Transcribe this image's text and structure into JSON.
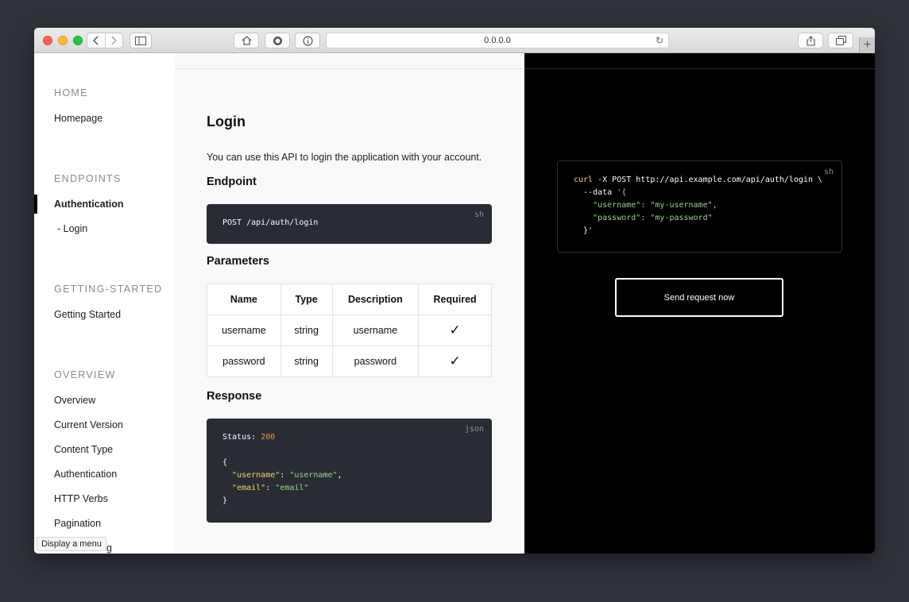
{
  "browser": {
    "url": "0.0.0.0",
    "colors": {
      "close": "#fc5f57",
      "minimize": "#fdbb2e",
      "zoom": "#28c840"
    }
  },
  "sidebar": {
    "sections": [
      {
        "title": "HOME",
        "items": [
          "Homepage"
        ]
      },
      {
        "title": "ENDPOINTS",
        "items": [
          "Authentication",
          "- Login"
        ]
      },
      {
        "title": "GETTING-STARTED",
        "items": [
          "Getting Started"
        ]
      },
      {
        "title": "OVERVIEW",
        "items": [
          "Overview",
          "Current Version",
          "Content Type",
          "Authentication",
          "HTTP Verbs",
          "Pagination",
          "Rate Limiting"
        ]
      }
    ],
    "active_item": "Authentication",
    "tooltip": "Display a menu"
  },
  "content": {
    "title": "Login",
    "intro": "You can use this API to login the application with your account.",
    "endpoint_heading": "Endpoint",
    "endpoint_lang": "sh",
    "endpoint_code": "POST /api/auth/login",
    "parameters_heading": "Parameters",
    "table": {
      "headers": [
        "Name",
        "Type",
        "Description",
        "Required"
      ],
      "rows": [
        [
          "username",
          "string",
          "username",
          "✓"
        ],
        [
          "password",
          "string",
          "password",
          "✓"
        ]
      ]
    },
    "response_heading": "Response",
    "response_lang": "json",
    "response": {
      "status_label": "Status",
      "status_code": "200",
      "open_brace": "{",
      "username_key": "\"username\"",
      "username_value": "\"username\"",
      "email_key": "\"email\"",
      "email_value": "\"email\"",
      "close_brace": "}"
    }
  },
  "request": {
    "lang": "sh",
    "line1_cmd": "curl",
    "line1_rest": " -X POST http://api.example.com/api/auth/login \\",
    "line2_flag": "  --data",
    "line2_quote": " '{",
    "username_key": "\"username\"",
    "username_value": "\"my-username\"",
    "password_key": "\"password\"",
    "password_value": "\"my-password\"",
    "closing": "  }'",
    "button_label": "Send request now"
  }
}
